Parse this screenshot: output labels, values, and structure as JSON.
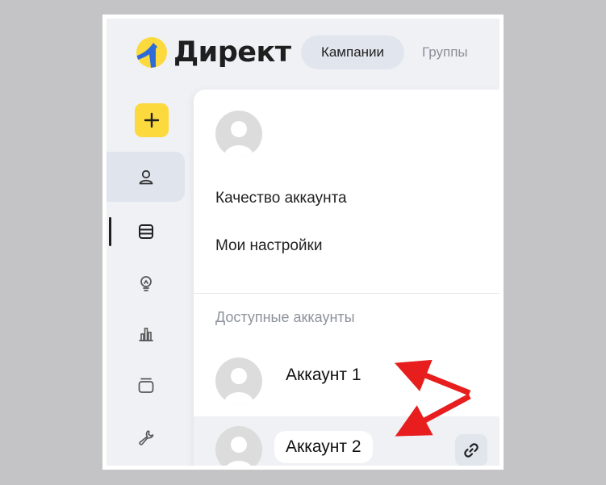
{
  "header": {
    "logo_text": "Директ",
    "tabs": [
      {
        "label": "Кампании",
        "active": true
      },
      {
        "label": "Группы",
        "active": false
      }
    ]
  },
  "sidebar": {
    "items": [
      {
        "icon": "plus-icon"
      },
      {
        "icon": "user-icon",
        "active": true
      },
      {
        "icon": "list-icon",
        "current": true
      },
      {
        "icon": "lightbulb-icon"
      },
      {
        "icon": "bar-chart-icon"
      },
      {
        "icon": "stack-icon"
      },
      {
        "icon": "wrench-icon"
      }
    ]
  },
  "menu": {
    "items": [
      {
        "label": "Качество аккаунта"
      },
      {
        "label": "Мои настройки"
      }
    ],
    "accounts_title": "Доступные аккаунты",
    "accounts": [
      {
        "name": "Аккаунт 1"
      },
      {
        "name": "Аккаунт 2"
      }
    ]
  },
  "colors": {
    "accent_yellow": "#fcd93c",
    "logo_blue": "#2f6bd8",
    "arrow_red": "#e81d1d"
  }
}
